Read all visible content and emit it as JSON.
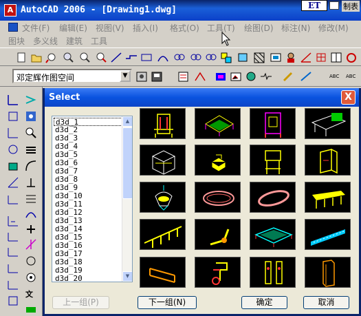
{
  "window": {
    "title": "AutoCAD 2006 - [Drawing1.dwg]",
    "app_icon_label": "A",
    "et_label": "ET",
    "right_label": "制表"
  },
  "menu": {
    "items": [
      "文件(F)",
      "编辑(E)",
      "视图(V)",
      "插入(I)",
      "格式(O)",
      "工具(T)",
      "绘图(D)",
      "标注(N)",
      "修改(M)"
    ],
    "row2": [
      "图块",
      "多义线",
      "建筑",
      "工具"
    ]
  },
  "toolbar": {
    "style_combo_value": "邓定辉作图空间"
  },
  "dialog": {
    "title": "Select",
    "close_label": "X",
    "items": [
      "d3d_1",
      "d3d_2",
      "d3d_3",
      "d3d_4",
      "d3d_5",
      "d3d_6",
      "d3d_7",
      "d3d_8",
      "d3d_9",
      "d3d_10",
      "d3d_11",
      "d3d_12",
      "d3d_13",
      "d3d_14",
      "d3d_15",
      "d3d_16",
      "d3d_17",
      "d3d_18",
      "d3d_19",
      "d3d_20"
    ],
    "selected_item": "d3d_1",
    "buttons": {
      "prev": "上一组(P)",
      "next": "下一组(N)",
      "ok": "确定",
      "cancel": "取消"
    },
    "preview_icons": [
      "chair-icon",
      "machine-icon",
      "frame-icon",
      "desk-icon",
      "cage-icon",
      "box-icon",
      "stand-icon",
      "cabinet-icon",
      "lamp-icon",
      "track-icon",
      "ring-icon",
      "table-icon",
      "swing-icon",
      "pipe-icon",
      "platform-icon",
      "conveyor-icon",
      "tray-icon",
      "valve-icon",
      "columns-icon",
      "tower-icon"
    ]
  },
  "colors": {
    "accent": "#0a53df",
    "cad_yellow": "#ffff00",
    "cad_red": "#ff3030",
    "cad_cyan": "#00ffff"
  }
}
